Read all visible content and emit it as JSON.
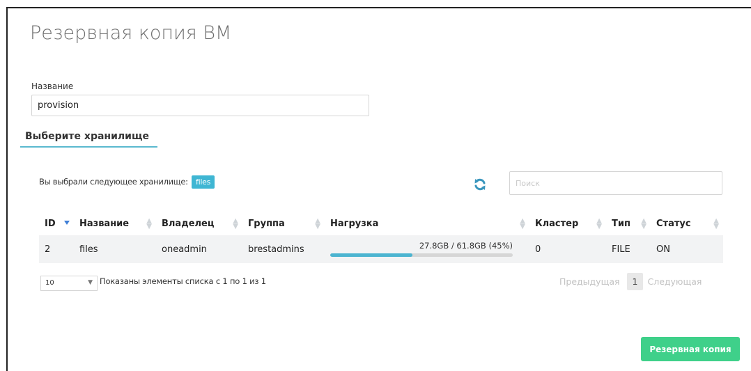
{
  "dialog": {
    "title": "Резервная копия ВМ",
    "name_label": "Название",
    "name_value": "provision",
    "section_title": "Выберите хранилище",
    "selected_prefix": "Вы выбрали следующее хранилище:",
    "selected_value": "files",
    "search_placeholder": "Поиск"
  },
  "table": {
    "headers": [
      "ID",
      "Название",
      "Владелец",
      "Группа",
      "Нагрузка",
      "Кластер",
      "Тип",
      "Статус"
    ],
    "rows": [
      {
        "id": "2",
        "name": "files",
        "owner": "oneadmin",
        "group": "brestadmins",
        "load_text": "27.8GB / 61.8GB (45%)",
        "load_fraction": 0.45,
        "cluster": "0",
        "type": "FILE",
        "status": "ON"
      }
    ]
  },
  "footer": {
    "page_length": "10",
    "info": "Показаны элементы списка с 1 по 1 из 1",
    "prev": "Предыдущая",
    "page": "1",
    "next": "Следующая"
  },
  "actions": {
    "submit_label": "Резервная копия"
  },
  "colors": {
    "accent": "#3fb6d3",
    "submit": "#3fd08a",
    "sort_active": "#3f7fd6"
  },
  "icons": {
    "refresh": "refresh-icon",
    "sort": "sort-icon",
    "caret": "chevron-down-icon"
  }
}
